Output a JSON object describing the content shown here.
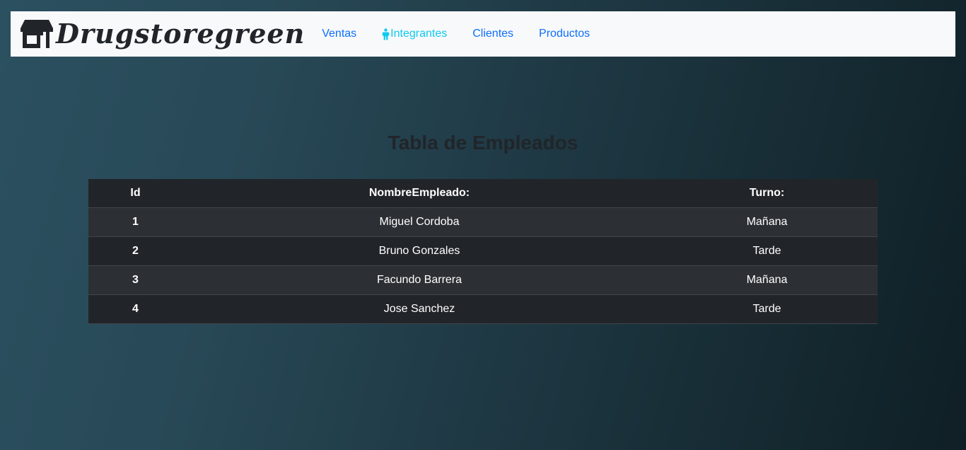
{
  "navbar": {
    "brand": "Drugstoregreen",
    "links": [
      {
        "label": "Ventas",
        "active": false
      },
      {
        "label": "Integrantes",
        "active": true,
        "icon": "person-icon"
      },
      {
        "label": "Clientes",
        "active": false
      },
      {
        "label": "Productos",
        "active": false
      }
    ]
  },
  "page": {
    "title": "Tabla de Empleados"
  },
  "table": {
    "headers": [
      "Id",
      "NombreEmpleado:",
      "Turno:"
    ],
    "rows": [
      [
        "1",
        "Miguel Cordoba",
        "Mañana"
      ],
      [
        "2",
        "Bruno Gonzales",
        "Tarde"
      ],
      [
        "3",
        "Facundo Barrera",
        "Mañana"
      ],
      [
        "4",
        "Jose Sanchez",
        "Tarde"
      ]
    ]
  },
  "colors": {
    "link": "#0d6efd",
    "link_active": "#0dcaf0",
    "table_dark": "#212529",
    "table_striped": "#2c3034"
  }
}
